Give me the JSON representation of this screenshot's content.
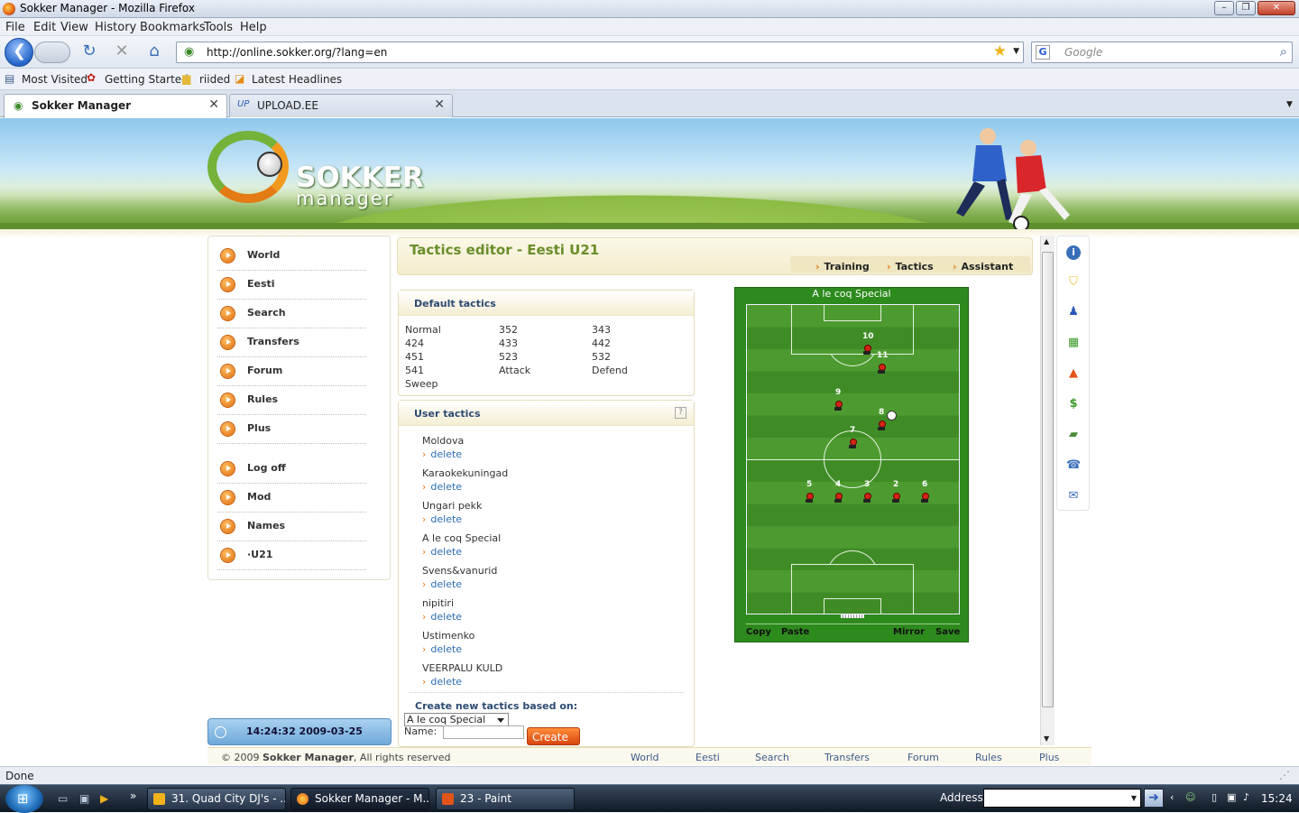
{
  "window": {
    "title": "Sokker Manager - Mozilla Firefox"
  },
  "menu": [
    "File",
    "Edit",
    "View",
    "History",
    "Bookmarks",
    "Tools",
    "Help"
  ],
  "url": "http://online.sokker.org/?lang=en",
  "search": {
    "placeholder": "Google"
  },
  "bookmarks": [
    "Most Visited",
    "Getting Started",
    "riided",
    "Latest Headlines"
  ],
  "tabs": [
    {
      "label": "Sokker Manager"
    },
    {
      "label": "UPLOAD.EE"
    }
  ],
  "logo": {
    "line1": "SOKKER",
    "line2": "manager"
  },
  "leftnav": [
    "World",
    "Eesti",
    "Search",
    "Transfers",
    "Forum",
    "Rules",
    "Plus",
    "Log off",
    "Mod",
    "Names",
    "·U21"
  ],
  "clock": "14:24:32  2009-03-25",
  "main": {
    "title": "Tactics editor - Eesti U21",
    "links": [
      "Training",
      "Tactics",
      "Assistant"
    ]
  },
  "default_tactics": {
    "title": "Default tactics",
    "items": [
      "Normal",
      "352",
      "343",
      "424",
      "433",
      "442",
      "451",
      "523",
      "532",
      "541",
      "Attack",
      "Defend",
      "Sweep"
    ]
  },
  "user_tactics": {
    "title": "User tactics",
    "help": "?",
    "delete_label": "delete",
    "items": [
      "Moldova",
      "Karaokekuningad",
      "Ungari pekk",
      "A le coq Special",
      "Svens&vanurid",
      "nipitiri",
      "Ustimenko",
      "VEERPALU KULD"
    ]
  },
  "create": {
    "label": "Create new tactics based on:",
    "selected": "A le coq Special",
    "name_label": "Name:",
    "button": "Create"
  },
  "field": {
    "name": "A le coq Special",
    "players": [
      "10",
      "11",
      "9",
      "8",
      "7",
      "5",
      "4",
      "3",
      "2",
      "6"
    ],
    "buttons": [
      "Copy",
      "Paste",
      "Mirror",
      "Save"
    ]
  },
  "footer": {
    "copyright_pre": "© 2009 ",
    "copyright_brand": "Sokker Manager",
    "copyright_post": ", All rights reserved",
    "links": [
      "World",
      "Eesti",
      "Search",
      "Transfers",
      "Forum",
      "Rules",
      "Plus"
    ]
  },
  "status": "Done",
  "taskbar": {
    "tasks": [
      "31. Quad City DJ's - ...",
      "Sokker Manager - M...",
      "23 - Paint"
    ],
    "address_label": "Address",
    "time": "15:24"
  }
}
